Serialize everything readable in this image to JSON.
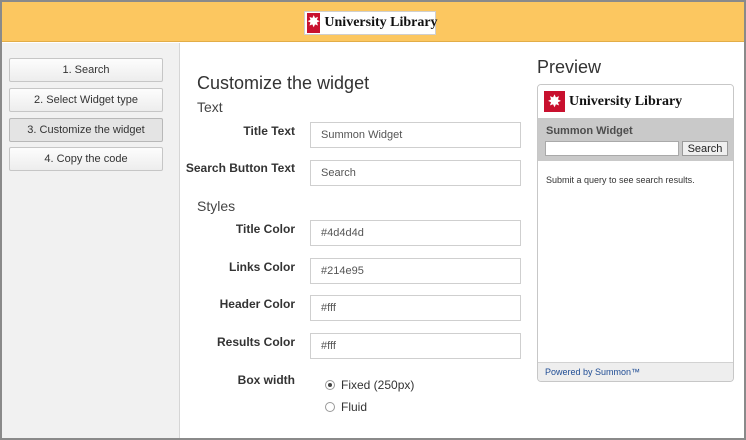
{
  "header": {
    "logo_glyph": "✸",
    "logo_text": "University Library",
    "brand_color": "#c8102e",
    "bar_color": "#fcc760"
  },
  "sidebar": {
    "steps": [
      {
        "label": "1. Search",
        "active": false
      },
      {
        "label": "2. Select Widget type",
        "active": false
      },
      {
        "label": "3. Customize the widget",
        "active": true
      },
      {
        "label": "4. Copy the code",
        "active": false
      }
    ]
  },
  "main": {
    "title": "Customize the widget",
    "text_section": "Text",
    "styles_section": "Styles",
    "fields": {
      "title_text": {
        "label": "Title Text",
        "value": "Summon Widget"
      },
      "search_button_text": {
        "label": "Search Button Text",
        "value": "Search"
      },
      "title_color": {
        "label": "Title Color",
        "value": "#4d4d4d"
      },
      "links_color": {
        "label": "Links Color",
        "value": "#214e95"
      },
      "header_color": {
        "label": "Header Color",
        "value": "#fff"
      },
      "results_color": {
        "label": "Results Color",
        "value": "#fff"
      }
    },
    "box_width": {
      "label": "Box width",
      "options": [
        {
          "label": "Fixed (250px)",
          "selected": true
        },
        {
          "label": "Fluid",
          "selected": false
        }
      ]
    }
  },
  "preview": {
    "heading": "Preview",
    "logo_text": "University Library",
    "widget_title": "Summon Widget",
    "search_button": "Search",
    "message": "Submit a query to see search results.",
    "powered_by": "Powered by Summon™"
  }
}
